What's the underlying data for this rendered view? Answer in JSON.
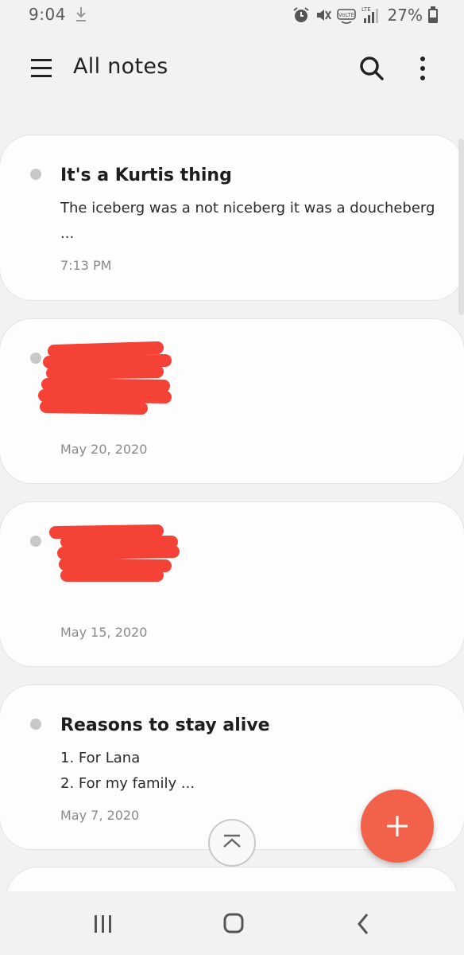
{
  "status_bar": {
    "time": "9:04",
    "battery_percent": "27%",
    "icons": [
      "download-icon",
      "alarm-icon",
      "mute-icon",
      "volte-icon",
      "lte-signal-icon",
      "battery-icon"
    ],
    "volte_label": "VoLTE",
    "lte_label": "LTE"
  },
  "app_bar": {
    "title": "All notes",
    "menu_icon": "hamburger-menu-icon",
    "search_icon": "search-icon",
    "more_icon": "more-options-icon"
  },
  "notes": [
    {
      "title": "It's a Kurtis thing",
      "body_line1": "The iceberg was a not niceberg it was a doucheberg",
      "body_line2": "...",
      "date": "7:13 PM"
    },
    {
      "title": "",
      "redacted": true,
      "date": "May 20, 2020"
    },
    {
      "title": "",
      "redacted": true,
      "date": "May 15, 2020"
    },
    {
      "title": "Reasons to stay alive",
      "body_line1": "1. For Lana",
      "body_line2": "2. For my family ...",
      "date": "May 7, 2020"
    }
  ],
  "colors": {
    "fab": "#f2624a",
    "redaction": "#f44336",
    "background": "#f2f2f2",
    "card": "#fdfdfd"
  },
  "fab": {
    "icon": "plus-icon"
  },
  "scroll_top": {
    "icon": "scroll-to-top-icon"
  },
  "nav_bar": {
    "recents_icon": "recent-apps-icon",
    "home_icon": "home-icon",
    "back_icon": "back-icon"
  }
}
